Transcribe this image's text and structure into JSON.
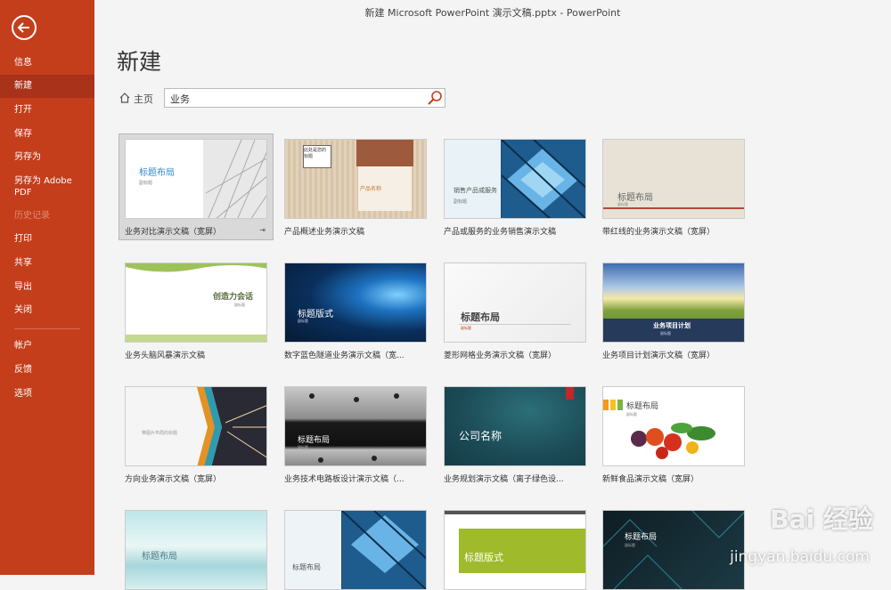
{
  "window": {
    "title": "新建 Microsoft PowerPoint 演示文稿.pptx  -  PowerPoint"
  },
  "sidebar": {
    "items": [
      {
        "label": "信息"
      },
      {
        "label": "新建"
      },
      {
        "label": "打开"
      },
      {
        "label": "保存"
      },
      {
        "label": "另存为"
      },
      {
        "label": "另存为 Adobe PDF"
      },
      {
        "label": "历史记录"
      },
      {
        "label": "打印"
      },
      {
        "label": "共享"
      },
      {
        "label": "导出"
      },
      {
        "label": "关闭"
      },
      {
        "label": "帐户"
      },
      {
        "label": "反馈"
      },
      {
        "label": "选项"
      }
    ]
  },
  "main": {
    "title": "新建",
    "home_label": "主页",
    "search_value": "业务"
  },
  "templates": [
    {
      "label": "业务对比演示文稿（宽屏）",
      "thumb_title": "标题布局",
      "thumb_sub": "副标题"
    },
    {
      "label": "产品概述业务演示文稿",
      "thumb_title": "产品名称",
      "thumb_sub": "此处是您的标题"
    },
    {
      "label": "产品或服务的业务销售演示文稿",
      "thumb_title": "销售产品或服务",
      "thumb_sub": "副标题"
    },
    {
      "label": "带红线的业务演示文稿（宽屏）",
      "thumb_title": "标题布局",
      "thumb_sub": "副标题"
    },
    {
      "label": "业务头脑风暴演示文稿",
      "thumb_title": "创造力会话",
      "thumb_sub": "副标题"
    },
    {
      "label": "数字蓝色隧道业务演示文稿（宽...",
      "thumb_title": "标题版式",
      "thumb_sub": "副标题"
    },
    {
      "label": "菱形网格业务演示文稿（宽屏）",
      "thumb_title": "标题布局",
      "thumb_sub": "副标题"
    },
    {
      "label": "业务项目计划演示文稿（宽屏）",
      "thumb_title": "业务项目计划",
      "thumb_sub": "副标题"
    },
    {
      "label": "方向业务演示文稿（宽屏）",
      "thumb_title": "带图片布局的标题",
      "thumb_sub": ""
    },
    {
      "label": "业务技术电路板设计演示文稿（...",
      "thumb_title": "标题布局",
      "thumb_sub": "副标题"
    },
    {
      "label": "业务规划演示文稿（离子绿色设...",
      "thumb_title": "公司名称",
      "thumb_sub": ""
    },
    {
      "label": "新鲜食品演示文稿（宽屏）",
      "thumb_title": "标题布局",
      "thumb_sub": "副标题"
    },
    {
      "label": "",
      "thumb_title": "标题布局",
      "thumb_sub": ""
    },
    {
      "label": "",
      "thumb_title": "标题布局",
      "thumb_sub": ""
    },
    {
      "label": "",
      "thumb_title": "标题版式",
      "thumb_sub": ""
    },
    {
      "label": "",
      "thumb_title": "标题布局",
      "thumb_sub": "副标题"
    }
  ],
  "watermark": {
    "text": "Bai 经验",
    "url_text": "jingyan.baidu.com"
  },
  "colors": {
    "sidebar": "#c43e1c",
    "accent": "#c43e1c",
    "background": "#f4f4f4"
  }
}
